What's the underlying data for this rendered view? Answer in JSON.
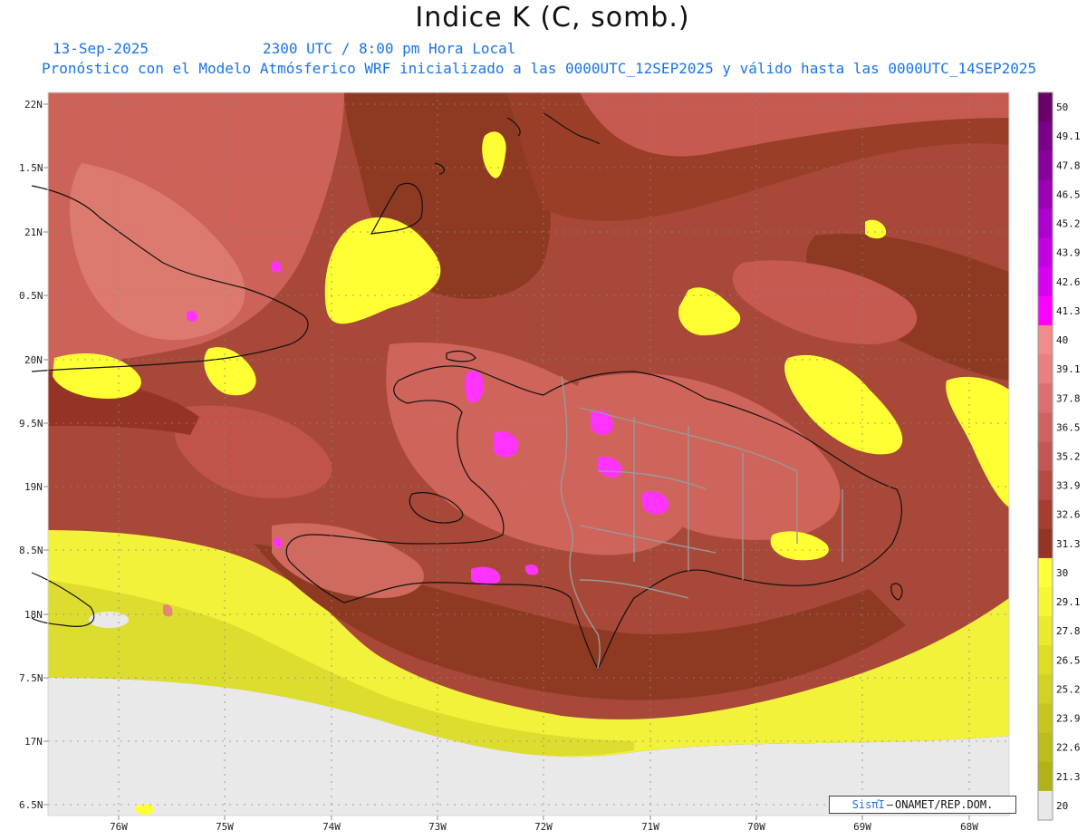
{
  "header": {
    "title": "Indice K (C, somb.)",
    "date": "13-Sep-2025",
    "time": "2300 UTC / 8:00 pm Hora Local",
    "forecast": "Pronóstico con el Modelo Atmósferico WRF inicializado a las 0000UTC_12SEP2025 y válido hasta las  0000UTC_14SEP2025"
  },
  "axes": {
    "lat_labels": [
      "22N",
      "1.5N",
      "21N",
      "0.5N",
      "20N",
      "9.5N",
      "19N",
      "8.5N",
      "18N",
      "7.5N",
      "17N",
      "6.5N"
    ],
    "lon_labels": [
      "76W",
      "75W",
      "74W",
      "73W",
      "72W",
      "71W",
      "70W",
      "69W",
      "68W"
    ]
  },
  "colorbar": {
    "labels": [
      "50",
      "49.1",
      "47.8",
      "46.5",
      "45.2",
      "43.9",
      "42.6",
      "41.3",
      "40",
      "39.1",
      "37.8",
      "36.5",
      "35.2",
      "33.9",
      "32.6",
      "31.3",
      "30",
      "29.1",
      "27.8",
      "26.5",
      "25.2",
      "23.9",
      "22.6",
      "21.3",
      "20"
    ],
    "colors": [
      "#6a006a",
      "#7a0088",
      "#8a009e",
      "#9c00b4",
      "#ae00cc",
      "#c200e0",
      "#d800f0",
      "#ff00ff",
      "#f08c8c",
      "#e88080",
      "#dc7070",
      "#d06262",
      "#c45656",
      "#b64a42",
      "#a63e30",
      "#943424",
      "#ffff3a",
      "#f6f632",
      "#eaea2c",
      "#dede26",
      "#d2d222",
      "#c6c61e",
      "#bcbc1a",
      "#b2b218",
      "#e8e8e8"
    ]
  },
  "credit": {
    "system": "SisπΊ",
    "text": "ONAMET/REP.DOM."
  },
  "colors": {
    "maroon": "#8e3a22",
    "brick": "#b45040",
    "salmon": "#d46a62",
    "pink": "#e6857c",
    "yellow": "#ffff33",
    "olive_yellow": "#e4e436",
    "magenta": "#ff33ff",
    "nodata": "#e9e9e9"
  }
}
